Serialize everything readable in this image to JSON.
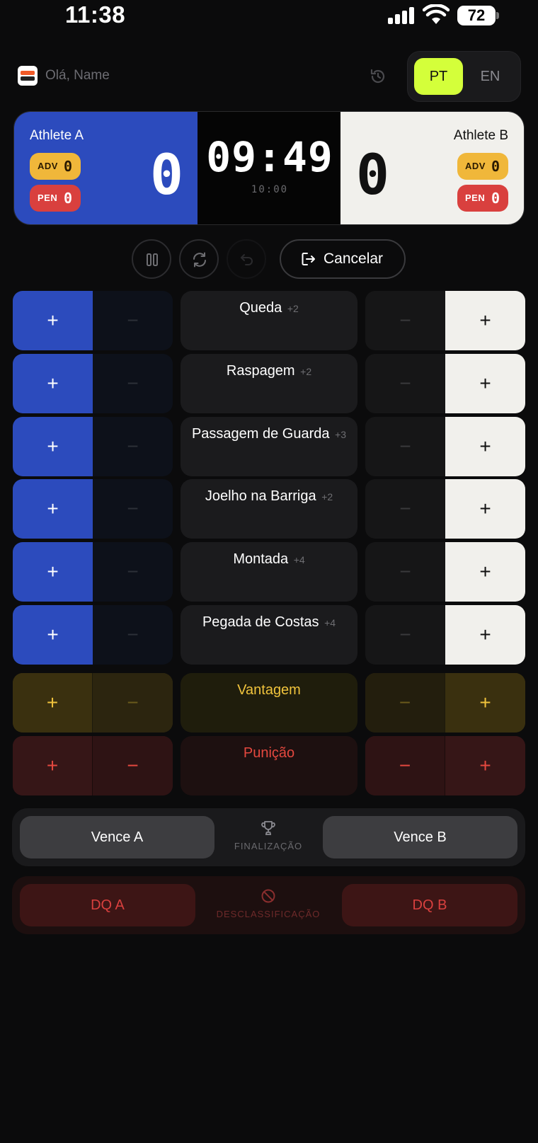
{
  "status_bar": {
    "time": "11:38",
    "battery": "72"
  },
  "header": {
    "greeting": "Olá, Name",
    "lang_options": [
      "PT",
      "EN"
    ],
    "lang_selected": "PT"
  },
  "scoreboard": {
    "athlete_a": {
      "name": "Athlete A",
      "adv_label": "ADV",
      "adv": "0",
      "pen_label": "PEN",
      "pen": "0",
      "score": "0",
      "color": "#2c4bbd"
    },
    "athlete_b": {
      "name": "Athlete B",
      "adv_label": "ADV",
      "adv": "0",
      "pen_label": "PEN",
      "pen": "0",
      "score": "0",
      "color": "#f1f0ec"
    },
    "clock": "09:49",
    "duration": "10:00"
  },
  "controls": {
    "cancel_label": "Cancelar"
  },
  "actions": [
    {
      "label": "Queda",
      "points": "+2"
    },
    {
      "label": "Raspagem",
      "points": "+2"
    },
    {
      "label": "Passagem de Guarda",
      "points": "+3"
    },
    {
      "label": "Joelho na Barriga",
      "points": "+2"
    },
    {
      "label": "Montada",
      "points": "+4"
    },
    {
      "label": "Pegada de Costas",
      "points": "+4"
    }
  ],
  "advantage": {
    "label": "Vantagem",
    "color": "#f0c33c"
  },
  "penalty": {
    "label": "Punição",
    "color": "#e4483f"
  },
  "plus": "+",
  "minus": "−",
  "finish": {
    "win_a": "Vence A",
    "win_b": "Vence B",
    "label": "FINALIZAÇÃO"
  },
  "dq": {
    "dq_a": "DQ A",
    "dq_b": "DQ B",
    "label": "DESCLASSIFICAÇÃO"
  },
  "icons": {
    "status": [
      "signal-icon",
      "wifi-icon",
      "battery-icon"
    ],
    "controls": [
      "pause-icon",
      "reset-icon",
      "undo-icon",
      "exit-icon"
    ],
    "panels": [
      "trophy-icon",
      "ban-icon"
    ]
  }
}
